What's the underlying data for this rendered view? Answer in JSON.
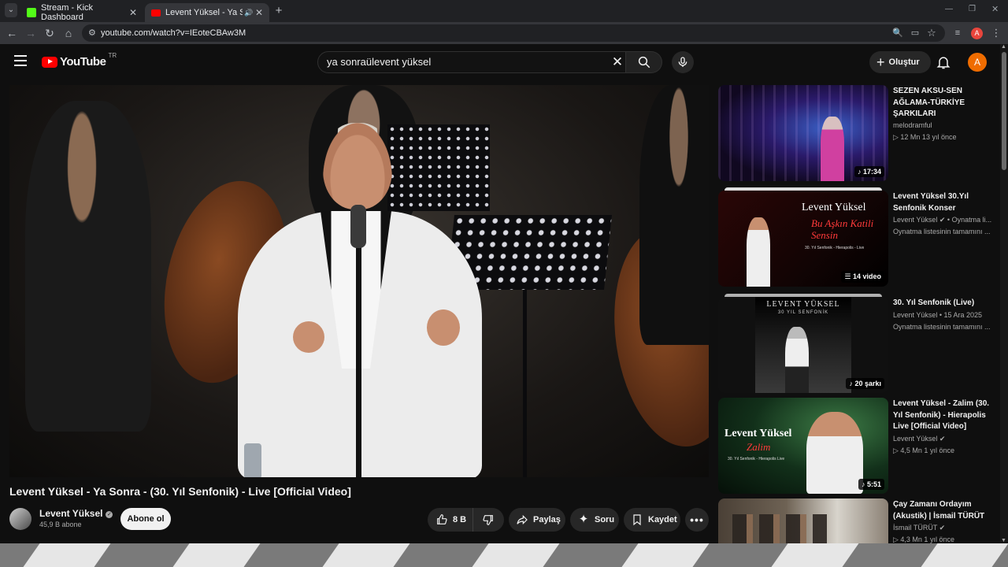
{
  "browser": {
    "tabs": [
      {
        "title": "Stream - Kick Dashboard",
        "favicon_color": "#53fc18",
        "active": false
      },
      {
        "title": "Levent Yüksel - Ya Sonra - (",
        "favicon_color": "#ff0000",
        "active": true
      }
    ],
    "new_tab": "+",
    "url": "youtube.com/watch?v=IEoteCBAw3M"
  },
  "youtube": {
    "logo_text": "YouTube",
    "country_code": "TR",
    "search_query": "ya sonraülevent yüksel",
    "create_label": "Oluştur",
    "avatar_letter": "A"
  },
  "video": {
    "title": "Levent Yüksel - Ya Sonra - (30. Yıl Senfonik) - Live [Official Video]",
    "channel": "Levent Yüksel",
    "subscribers": "45,9 B abone",
    "subscribe_label": "Abone ol",
    "likes": "8 B",
    "share_label": "Paylaş",
    "ask_label": "Soru",
    "save_label": "Kaydet"
  },
  "recommendations": [
    {
      "title": "SEZEN AKSU-SEN AĞLAMA-TÜRKİYE ŞARKILARI",
      "meta1": "melodramful",
      "meta2": "12 Mn   13 yıl önce",
      "badge": "17:34",
      "stacked": false
    },
    {
      "title": "Levent Yüksel 30.Yıl Senfonik Konser",
      "meta1": "Levent Yüksel ✔ • Oynatma li...",
      "meta2": "Oynatma listesinin tamamını ...",
      "badge": "14 video",
      "stacked": true,
      "thumb_title": "Levent Yüksel",
      "thumb_sub": "Bu Aşkın Katili Sensin",
      "thumb_caption": "30. Yıl Senfonik - Hierapolis - Live"
    },
    {
      "title": "30. Yıl Senfonik (Live)",
      "meta1": "Levent Yüksel • 15 Ara 2025",
      "meta2": "Oynatma listesinin tamamını ...",
      "badge": "20 şarkı",
      "stacked": true,
      "thumb_title": "LEVENT YÜKSEL",
      "thumb_sub": "30 YIL SENFONİK"
    },
    {
      "title": "Levent Yüksel - Zalim (30. Yıl Senfonik) - Hierapolis Live [Official Video]",
      "meta1": "Levent Yüksel ✔",
      "meta2": "4,5 Mn   1 yıl önce",
      "badge": "5:51",
      "stacked": false,
      "thumb_title": "Levent Yüksel",
      "thumb_sub": "Zalim",
      "thumb_caption": "30. Yıl Senfonik - Hierapolis Live"
    },
    {
      "title": "Çay Zamanı Ordayım (Akustik) | İsmail TÜRÜT",
      "meta1": "İsmail TÜRÜT ✔",
      "meta2": "4,3 Mn   1 yıl önce",
      "badge": "",
      "stacked": false
    }
  ]
}
